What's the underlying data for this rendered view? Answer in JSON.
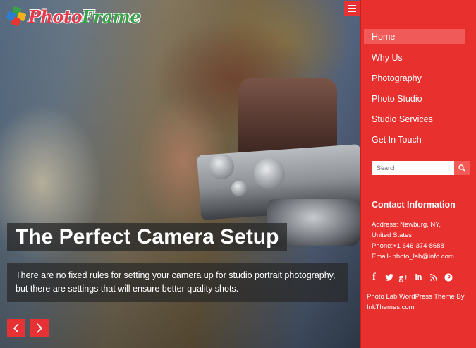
{
  "logo": {
    "part1": "Photo",
    "part2": "Frame"
  },
  "slide": {
    "title": "The Perfect Camera Setup",
    "description": "There are no fixed rules for setting your camera up for studio portrait photography, but there are settings that will ensure better quality shots."
  },
  "nav": {
    "items": [
      {
        "label": "Home"
      },
      {
        "label": "Why Us"
      },
      {
        "label": "Photography"
      },
      {
        "label": "Photo Studio"
      },
      {
        "label": "Studio Services"
      },
      {
        "label": "Get In Touch"
      }
    ]
  },
  "search": {
    "placeholder": "Search"
  },
  "contact": {
    "heading": "Contact Information",
    "address_line1": "Address: Newburg, NY,",
    "address_line2": "United States",
    "phone": "Phone:+1 646-374-8688",
    "email": "Email- photo_lab@info.com"
  },
  "social": {
    "facebook": "f",
    "twitter": "t",
    "googleplus": "g+",
    "linkedin": "in",
    "rss": "rss",
    "pinterest": "p"
  },
  "credit": "Photo Lab WordPress Theme By InkThemes.com",
  "colors": {
    "accent": "#e8302f",
    "active": "#f05a58"
  }
}
